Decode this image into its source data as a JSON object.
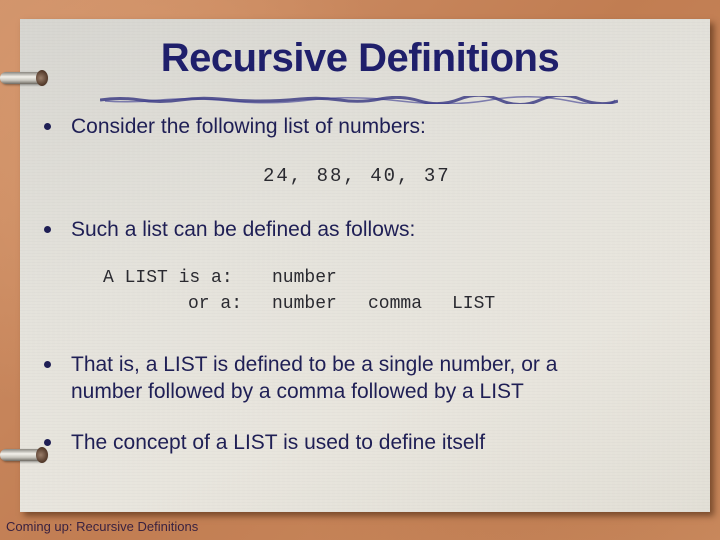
{
  "slide": {
    "title": "Recursive Definitions",
    "bullets": [
      {
        "text": "Consider the following list of numbers:"
      },
      {
        "text": "Such a list can be defined as follows:"
      },
      {
        "line1": "That is, a LIST is defined to be a single number, or a",
        "line2": "number followed by a comma followed by a LIST"
      },
      {
        "text": "The concept of a LIST is used to define itself"
      }
    ],
    "number_list": "24, 88, 40, 37",
    "definition": {
      "row1": {
        "label": "A LIST is a:",
        "parts": [
          "number"
        ]
      },
      "row2": {
        "label": "or a:",
        "parts": [
          "number",
          "comma",
          "LIST"
        ]
      }
    },
    "footer": "Coming up: Recursive Definitions"
  },
  "colors": {
    "title": "#1f1f6b",
    "text": "#1f1f55",
    "background": "#c9875a",
    "paper": "#e4e2db"
  }
}
